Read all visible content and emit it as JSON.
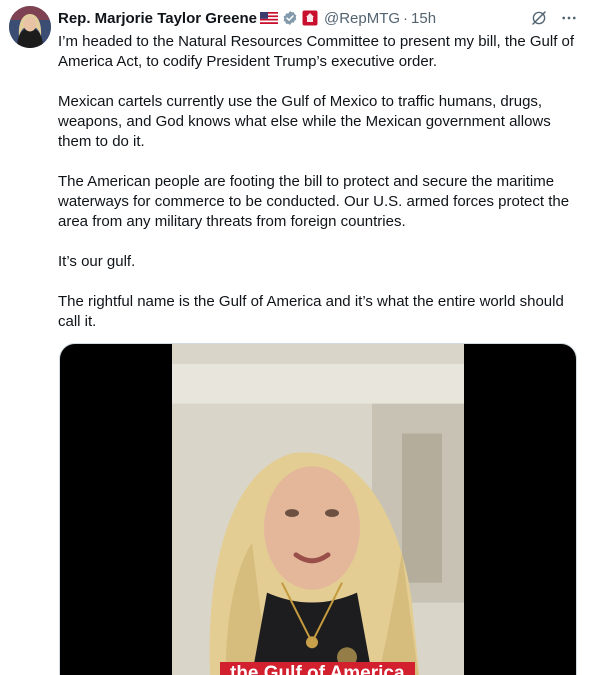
{
  "author": {
    "display_name": "Rep. Marjorie Taylor Greene",
    "handle": "@RepMTG",
    "separator": "·",
    "time": "15h"
  },
  "icons": {
    "flag": "us-flag-icon",
    "verified": "verified-badge-icon",
    "affiliation": "house-affiliation-icon",
    "grok": "grok-icon",
    "more": "more-options-icon"
  },
  "tweet": {
    "paragraphs": [
      "I’m headed to the Natural Resources Committee to present my bill, the Gulf of America Act, to codify President Trump’s executive order.",
      "Mexican cartels currently use the Gulf of Mexico to traffic humans, drugs, weapons, and God knows what else while the Mexican government allows them to do it.",
      "The American people are footing the bill to protect and secure the maritime waterways for commerce to be conducted. Our U.S. armed forces protect the area from any military threats from foreign countries.",
      "It’s our gulf.",
      "The rightful name is the Gulf of America and it’s what the entire world should call it."
    ]
  },
  "media": {
    "caption": "the Gulf of America"
  },
  "colors": {
    "text": "#0f1419",
    "secondary": "#536471",
    "verified": "#829aab",
    "caption_bg": "#d2202f"
  }
}
